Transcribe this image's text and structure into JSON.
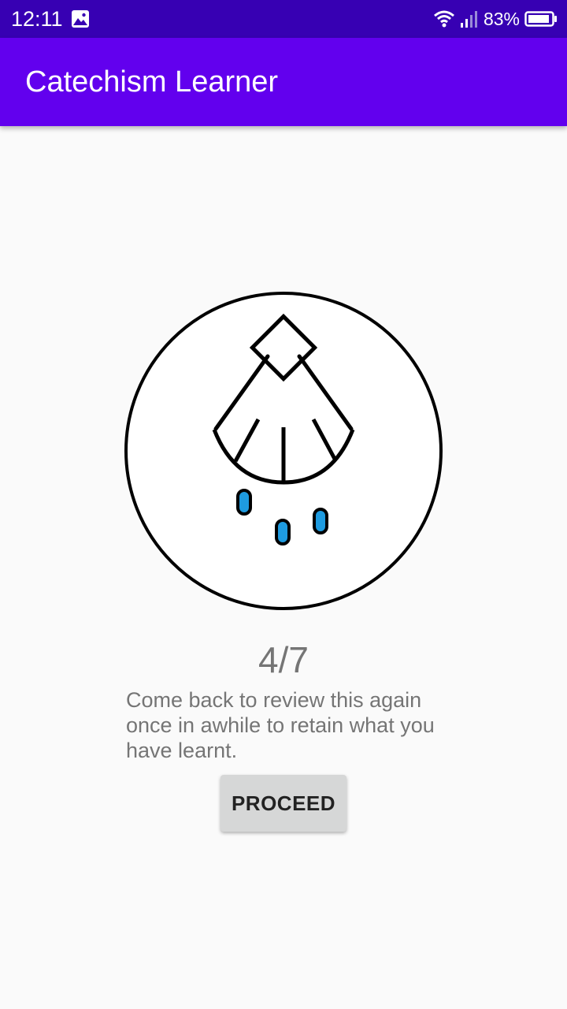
{
  "status_bar": {
    "time": "12:11",
    "battery_percent": "83%",
    "icons": [
      "gallery-icon",
      "wifi-icon",
      "signal-icon",
      "battery-icon"
    ]
  },
  "app_bar": {
    "title": "Catechism Learner"
  },
  "content": {
    "badge_icon": "sprinkler-holy-water-icon",
    "progress": "4/7",
    "message": "Come back to review this again once in awhile to retain what you have learnt.",
    "proceed_label": "PROCEED"
  },
  "colors": {
    "status_bar": "#3700b3",
    "app_bar": "#6200ee",
    "background": "#fafafa",
    "drop": "#1e9be0",
    "button": "#d6d7d7"
  }
}
